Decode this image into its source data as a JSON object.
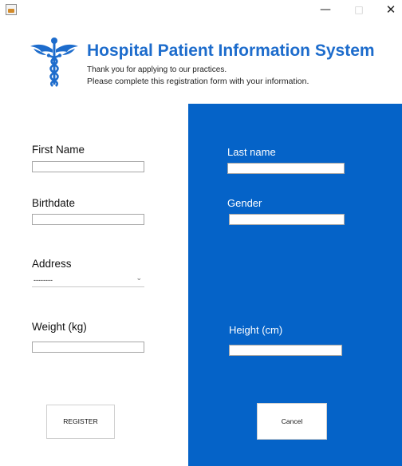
{
  "window": {
    "controls": {
      "minimize": "—",
      "maximize": "□",
      "close": "✕"
    }
  },
  "header": {
    "title": "Hospital Patient Information System",
    "subtitle_line1": "Thank you for applying to our practices.",
    "subtitle_line2": "Please complete this registration form with your information.",
    "logo_icon": "caduceus-icon",
    "accent_color": "#1d6ccc"
  },
  "form": {
    "first_name": {
      "label": "First Name",
      "value": ""
    },
    "last_name": {
      "label": "Last name",
      "value": ""
    },
    "birthdate": {
      "label": "Birthdate",
      "value": ""
    },
    "gender": {
      "label": "Gender",
      "value": ""
    },
    "address": {
      "label": "Address",
      "selected": "--------"
    },
    "weight": {
      "label": "Weight (kg)",
      "value": ""
    },
    "height": {
      "label": "Height (cm)",
      "value": ""
    }
  },
  "buttons": {
    "register": "REGISTER",
    "cancel": "Cancel"
  },
  "colors": {
    "right_panel": "#0563c8"
  }
}
